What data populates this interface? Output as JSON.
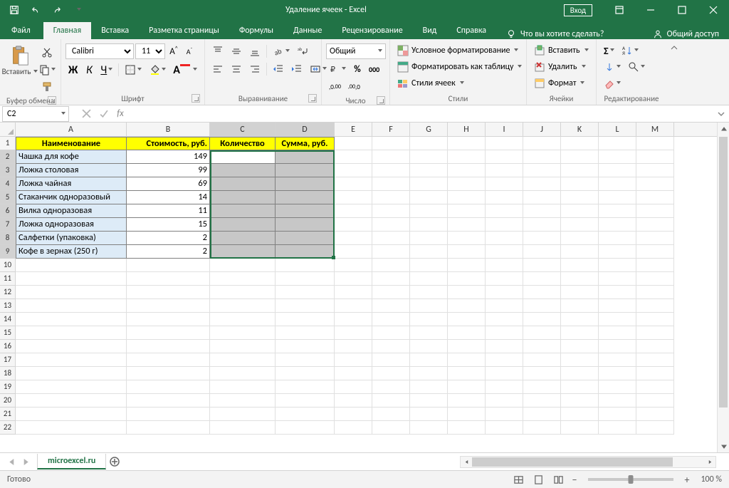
{
  "app": {
    "title": "Удаление ячеек  -  Excel",
    "login": "Вход"
  },
  "tabs": [
    "Файл",
    "Главная",
    "Вставка",
    "Разметка страницы",
    "Формулы",
    "Данные",
    "Рецензирование",
    "Вид",
    "Справка"
  ],
  "tellme": "Что вы хотите сделать?",
  "share": "Общий доступ",
  "ribbon": {
    "clipboard": {
      "paste": "Вставить",
      "label": "Буфер обмена"
    },
    "font": {
      "name": "Calibri",
      "size": "11",
      "label": "Шрифт"
    },
    "alignment": {
      "label": "Выравнивание"
    },
    "number": {
      "format": "Общий",
      "label": "Число"
    },
    "styles": {
      "cond": "Условное форматирование",
      "table": "Форматировать как таблицу",
      "cell": "Стили ячеек",
      "label": "Стили"
    },
    "cells": {
      "insert": "Вставить",
      "delete": "Удалить",
      "format": "Формат",
      "label": "Ячейки"
    },
    "editing": {
      "label": "Редактирование"
    }
  },
  "namebox": "C2",
  "columns": [
    "A",
    "B",
    "C",
    "D",
    "E",
    "F",
    "G",
    "H",
    "I",
    "J",
    "K",
    "L",
    "M"
  ],
  "headers": {
    "a": "Наименование",
    "b": "Стоимость, руб.",
    "c": "Количество",
    "d": "Сумма, руб."
  },
  "data": [
    {
      "name": "Чашка для кофе",
      "price": "149"
    },
    {
      "name": "Ложка столовая",
      "price": "99"
    },
    {
      "name": "Ложка чайная",
      "price": "69"
    },
    {
      "name": "Стаканчик одноразовый",
      "price": "14"
    },
    {
      "name": "Вилка одноразовая",
      "price": "11"
    },
    {
      "name": "Ложка одноразовая",
      "price": "15"
    },
    {
      "name": "Салфетки (упаковка)",
      "price": "2"
    },
    {
      "name": "Кофе в зернах (250 г)",
      "price": "2"
    }
  ],
  "sheet": {
    "name": "microexcel.ru"
  },
  "status": {
    "ready": "Готово",
    "zoom": "100 %"
  },
  "chart_data": {
    "type": "table",
    "columns": [
      "Наименование",
      "Стоимость, руб.",
      "Количество",
      "Сумма, руб."
    ],
    "rows": [
      [
        "Чашка для кофе",
        149,
        null,
        null
      ],
      [
        "Ложка столовая",
        99,
        null,
        null
      ],
      [
        "Ложка чайная",
        69,
        null,
        null
      ],
      [
        "Стаканчик одноразовый",
        14,
        null,
        null
      ],
      [
        "Вилка одноразовая",
        11,
        null,
        null
      ],
      [
        "Ложка одноразовая",
        15,
        null,
        null
      ],
      [
        "Салфетки (упаковка)",
        2,
        null,
        null
      ],
      [
        "Кофе в зернах (250 г)",
        2,
        null,
        null
      ]
    ]
  }
}
